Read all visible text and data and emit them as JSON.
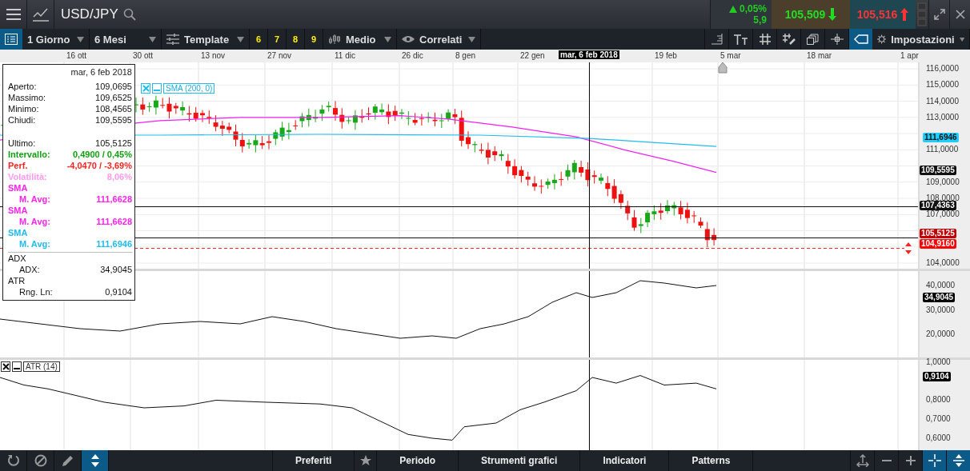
{
  "header": {
    "symbol": "USD/JPY",
    "change": "0,05%",
    "points": "5,9",
    "sell": "105,509",
    "buy": "105,516"
  },
  "toolbar": {
    "interval": "1 Giorno",
    "range": "6 Mesi",
    "template": "Template",
    "presets": [
      "6",
      "7",
      "8",
      "9"
    ],
    "chart_type": "Medio",
    "related": "Correlati",
    "settings": "Impostazioni",
    "tools": [
      {
        "kind": "ruler",
        "selected": false
      },
      {
        "kind": "text-size",
        "selected": false
      },
      {
        "kind": "grid",
        "selected": false
      },
      {
        "kind": "draw-grid",
        "selected": false
      },
      {
        "kind": "copy",
        "selected": false
      },
      {
        "kind": "crosshair",
        "selected": false
      },
      {
        "kind": "tag",
        "selected": true
      }
    ]
  },
  "date_axis": [
    "16 ott",
    "30 ott",
    "13 nov",
    "27 nov",
    "11 dic",
    "26 dic",
    "8 gen",
    "22 gen",
    "19 feb",
    "5 mar",
    "18 mar",
    "1 apr"
  ],
  "crosshair_date": "mar, 6 feb 2018",
  "legend": {
    "label": "SMA (200, 0)"
  },
  "price_axis": [
    "116,0000",
    "115,0000",
    "114,0000",
    "113,0000",
    "111,0000",
    "109,0000",
    "108,0000",
    "107,0000",
    "104,0000"
  ],
  "price_tags": [
    {
      "label": "111,6946",
      "color": "#22ccff"
    },
    {
      "label": "109,5595",
      "color": "#111111"
    },
    {
      "label": "107,4363",
      "color": "#111111"
    },
    {
      "label": "105,5125",
      "color": "#c00000"
    },
    {
      "label": "104,9160",
      "color": "#ff0000"
    }
  ],
  "info_panel": {
    "date": "mar, 6 feb 2018",
    "rows": [
      {
        "kind": "row",
        "label": "Aperto:",
        "value": "109,0695",
        "bold": false
      },
      {
        "kind": "row",
        "label": "Massimo:",
        "value": "109,6525",
        "bold": false
      },
      {
        "kind": "row",
        "label": "Minimo:",
        "value": "108,4565",
        "bold": false
      },
      {
        "kind": "row",
        "label": "Chiudi:",
        "value": "109,5595",
        "bold": false
      },
      {
        "kind": "gap-row",
        "label": "Ultimo:",
        "value": "105,5125",
        "bold": false
      },
      {
        "kind": "row",
        "label": "Intervallo:",
        "value": "0,4900 / 0,45%",
        "color": "#11a011",
        "bold": true
      },
      {
        "kind": "row",
        "label": "Perf.",
        "value": "-4,0470 / -3,69%",
        "color": "#ff2222",
        "bold": true
      },
      {
        "kind": "row",
        "label": "Volatilità:",
        "value": "8,06%",
        "color": "#ff99ee",
        "bold": true
      },
      {
        "kind": "section",
        "label": "SMA",
        "color": "#ff22ee",
        "bold": true
      },
      {
        "kind": "sub",
        "label": "M. Avg:",
        "value": "111,6628",
        "color": "#ff22ee",
        "bold": true
      },
      {
        "kind": "section",
        "label": "SMA",
        "color": "#ff22ee",
        "bold": true
      },
      {
        "kind": "sub",
        "label": "M. Avg:",
        "value": "111,6628",
        "color": "#ff22ee",
        "bold": true
      },
      {
        "kind": "section",
        "label": "SMA",
        "color": "#22bbee",
        "bold": true
      },
      {
        "kind": "sub",
        "label": "M. Avg:",
        "value": "111,6946",
        "color": "#22bbee",
        "bold": true
      },
      {
        "kind": "divided-section",
        "label": "ADX",
        "bold": false
      },
      {
        "kind": "sub",
        "label": "ADX:",
        "value": "34,9045",
        "bold": false
      },
      {
        "kind": "section",
        "label": "ATR",
        "bold": false
      },
      {
        "kind": "sub",
        "label": "Rng. Ln:",
        "value": "0,9104",
        "bold": false
      }
    ]
  },
  "adx_panel": {
    "ticks": [
      "40,0000",
      "30,0000",
      "20,0000"
    ],
    "tag": "34,9045"
  },
  "atr_panel": {
    "legend": "ATR (14)",
    "ticks": [
      "1,0000",
      "0,8000",
      "0,7000",
      "0,6000"
    ],
    "tag": "0,9104"
  },
  "bottom_bar": {
    "left_tools": [
      {
        "kind": "refresh",
        "selected": false
      },
      {
        "kind": "ban",
        "selected": false
      },
      {
        "kind": "pencil",
        "selected": false
      },
      {
        "kind": "updown",
        "selected": true
      }
    ],
    "tabs": [
      "Preferiti",
      "Periodo",
      "Strumenti grafici",
      "Indicatori",
      "Patterns"
    ],
    "right_tools": [
      {
        "kind": "move",
        "selected": false
      },
      {
        "kind": "minus",
        "selected": false
      },
      {
        "kind": "plus",
        "selected": false
      },
      {
        "kind": "crosshair",
        "selected": true
      },
      {
        "kind": "updown",
        "selected": true
      }
    ]
  }
}
